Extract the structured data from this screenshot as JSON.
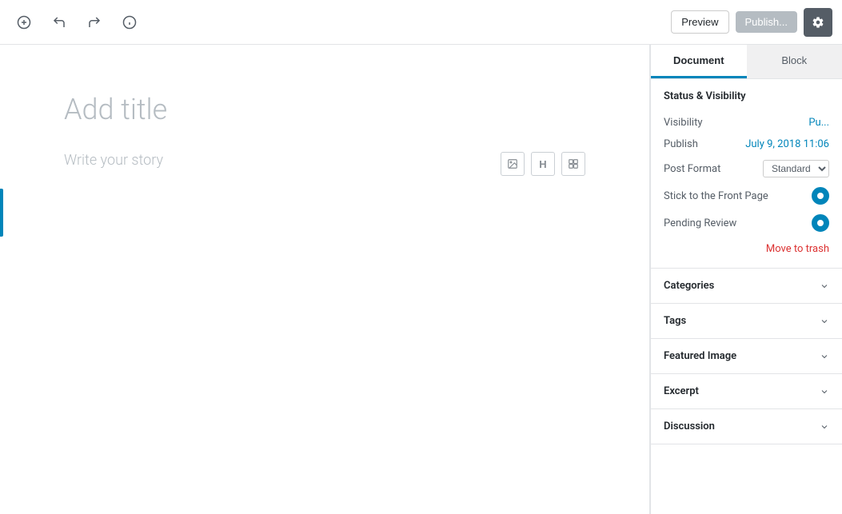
{
  "toolbar": {
    "add_label": "+",
    "undo_label": "↩",
    "redo_label": "↪",
    "info_label": "ℹ",
    "preview_label": "Preview",
    "publish_label": "Publish...",
    "settings_label": "⚙"
  },
  "editor": {
    "title_placeholder": "Add title",
    "body_placeholder": "Write your story",
    "inline_tools": {
      "image_tool": "▦",
      "heading_tool": "H",
      "gallery_tool": "▤"
    }
  },
  "sidebar": {
    "tab_document": "Document",
    "tab_block": "Block",
    "sections": {
      "status_visibility": {
        "title": "Status & Visibility",
        "visibility_label": "Visibility",
        "visibility_value": "Pu...",
        "publish_label": "Publish",
        "publish_value": "July 9, 2018 11:06",
        "post_format_label": "Post Format",
        "post_format_value": "Standard",
        "stick_label": "Stick to the Front Page",
        "pending_label": "Pending Review",
        "move_to_trash": "Move to trash"
      },
      "categories": {
        "title": "Categories"
      },
      "tags": {
        "title": "Tags"
      },
      "featured_image": {
        "title": "Featured Image"
      },
      "excerpt": {
        "title": "Excerpt"
      },
      "discussion": {
        "title": "Discussion"
      }
    }
  }
}
